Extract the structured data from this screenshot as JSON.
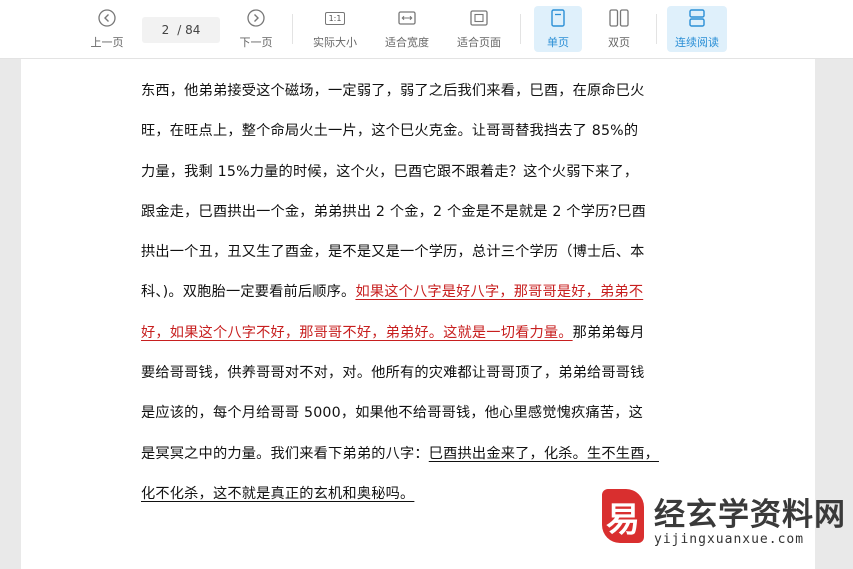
{
  "toolbar": {
    "prev_label": "上一页",
    "page_current": "2",
    "page_total": "/ 84",
    "next_label": "下一页",
    "actual_size_label": "实际大小",
    "actual_size_icon_text": "1:1",
    "fit_width_label": "适合宽度",
    "fit_page_label": "适合页面",
    "single_page_label": "单页",
    "double_page_label": "双页",
    "continuous_label": "连续阅读",
    "accent_color": "#2b8fd6"
  },
  "document": {
    "lines": [
      {
        "a": "东西，他弟弟接受这个磁场，一定弱了，弱了之后我们来看，巳酉，在原命巳火"
      },
      {
        "a": "旺，在旺点上，整个命局火土一片，这个巳火克金。让哥哥替我挡去了 85%的"
      },
      {
        "a": "力量，我剩 15%力量的时候，这个火，巳酉它跟不跟着走？这个火弱下来了，"
      },
      {
        "a": "跟金走，巳酉拱出一个金，弟弟拱出 2 个金，2 个金是不是就是 2 个学历?巳酉"
      },
      {
        "a": "拱出一个丑，丑又生了酉金，是不是又是一个学历，总计三个学历（博士后、本"
      },
      {
        "a": "科、)。双胞胎一定要看前后顺序。",
        "red": "如果这个八字是好八字，那哥哥是好，弟弟不"
      },
      {
        "red": "好，如果这个八字不好，那哥哥不好，弟弟好。这就是一切看力量。",
        "b": "那弟弟每月"
      },
      {
        "a": "要给哥哥钱，供养哥哥对不对，对。他所有的灾难都让哥哥顶了，弟弟给哥哥钱"
      },
      {
        "a": "是应该的，每个月给哥哥 5000，如果他不给哥哥钱，他心里感觉愧疚痛苦，这"
      },
      {
        "a": "是冥冥之中的力量。我们来看下弟弟的八字：",
        "ul": "巳酉拱出金来了，化杀。生不生酉，"
      },
      {
        "ul": "化不化杀，这不就是真正的玄机和奥秘吗。"
      }
    ]
  },
  "watermark": {
    "title": "经玄学资料网",
    "url": "yijingxuanxue.com"
  }
}
